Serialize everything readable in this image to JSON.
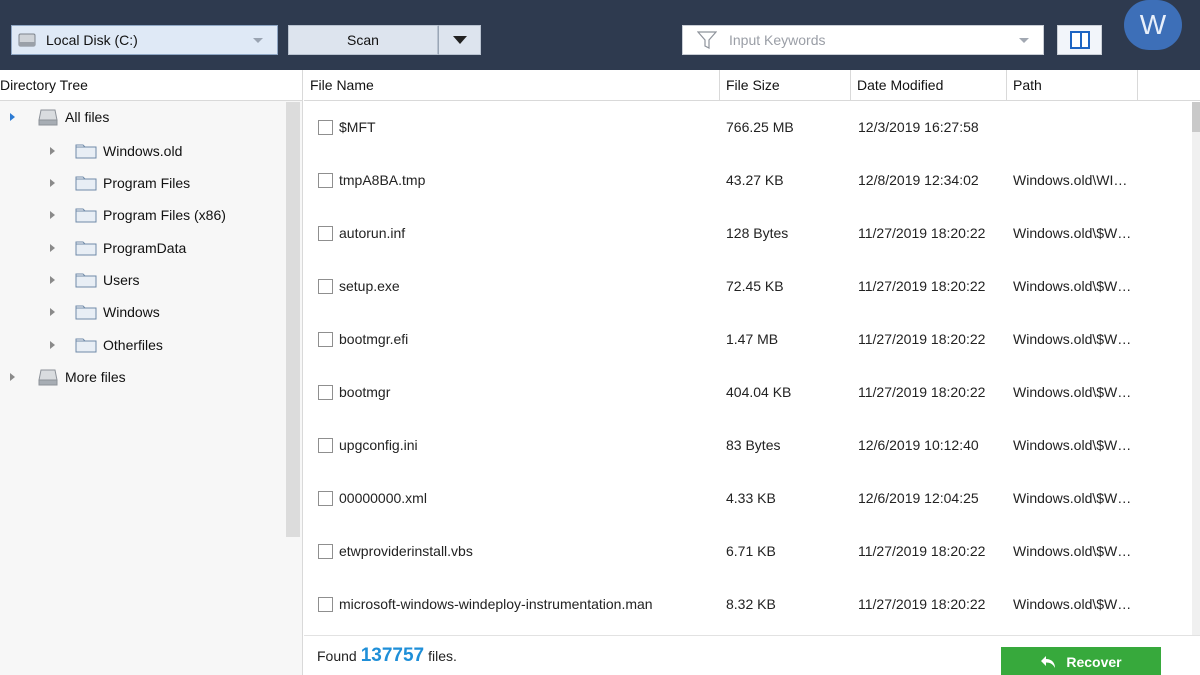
{
  "toolbar": {
    "drive_label": "Local Disk (C:)",
    "scan_label": "Scan",
    "search_placeholder": "Input Keywords",
    "avatar_letter": "W"
  },
  "tree": {
    "header": "Directory Tree",
    "items": [
      {
        "label": "All files",
        "icon": "drive-icon",
        "level": 0,
        "expanded": true
      },
      {
        "label": "Windows.old",
        "icon": "folder-icon",
        "level": 1
      },
      {
        "label": "Program Files",
        "icon": "folder-icon",
        "level": 1
      },
      {
        "label": "Program Files (x86)",
        "icon": "folder-icon",
        "level": 1
      },
      {
        "label": "ProgramData",
        "icon": "folder-icon",
        "level": 1
      },
      {
        "label": "Users",
        "icon": "folder-icon",
        "level": 1
      },
      {
        "label": "Windows",
        "icon": "folder-icon",
        "level": 1
      },
      {
        "label": "Otherfiles",
        "icon": "folder-icon",
        "level": 1
      },
      {
        "label": "More files",
        "icon": "drive-icon",
        "level": 0
      }
    ]
  },
  "list": {
    "columns": [
      "File Name",
      "File Size",
      "Date Modified",
      "Path"
    ],
    "rows": [
      {
        "name": "$MFT",
        "size": "766.25 MB",
        "date": "12/3/2019 16:27:58",
        "path": ""
      },
      {
        "name": "tmpA8BA.tmp",
        "size": "43.27 KB",
        "date": "12/8/2019 12:34:02",
        "path": "Windows.old\\WI…"
      },
      {
        "name": "autorun.inf",
        "size": "128 Bytes",
        "date": "11/27/2019 18:20:22",
        "path": "Windows.old\\$W…"
      },
      {
        "name": "setup.exe",
        "size": "72.45 KB",
        "date": "11/27/2019 18:20:22",
        "path": "Windows.old\\$W…"
      },
      {
        "name": "bootmgr.efi",
        "size": "1.47 MB",
        "date": "11/27/2019 18:20:22",
        "path": "Windows.old\\$W…"
      },
      {
        "name": "bootmgr",
        "size": "404.04 KB",
        "date": "11/27/2019 18:20:22",
        "path": "Windows.old\\$W…"
      },
      {
        "name": "upgconfig.ini",
        "size": "83 Bytes",
        "date": "12/6/2019 10:12:40",
        "path": "Windows.old\\$W…"
      },
      {
        "name": "00000000.xml",
        "size": "4.33 KB",
        "date": "12/6/2019 12:04:25",
        "path": "Windows.old\\$W…"
      },
      {
        "name": "etwproviderinstall.vbs",
        "size": "6.71 KB",
        "date": "11/27/2019 18:20:22",
        "path": "Windows.old\\$W…"
      },
      {
        "name": "microsoft-windows-windeploy-instrumentation.man",
        "size": "8.32 KB",
        "date": "11/27/2019 18:20:22",
        "path": "Windows.old\\$W…"
      }
    ]
  },
  "status": {
    "found_prefix": "Found",
    "found_count": "137757",
    "found_suffix": "files.",
    "recover_label": "Recover"
  },
  "colors": {
    "topbar": "#2e3a4f",
    "accent_blue": "#1f8fd8",
    "recover_green": "#37a93c"
  }
}
